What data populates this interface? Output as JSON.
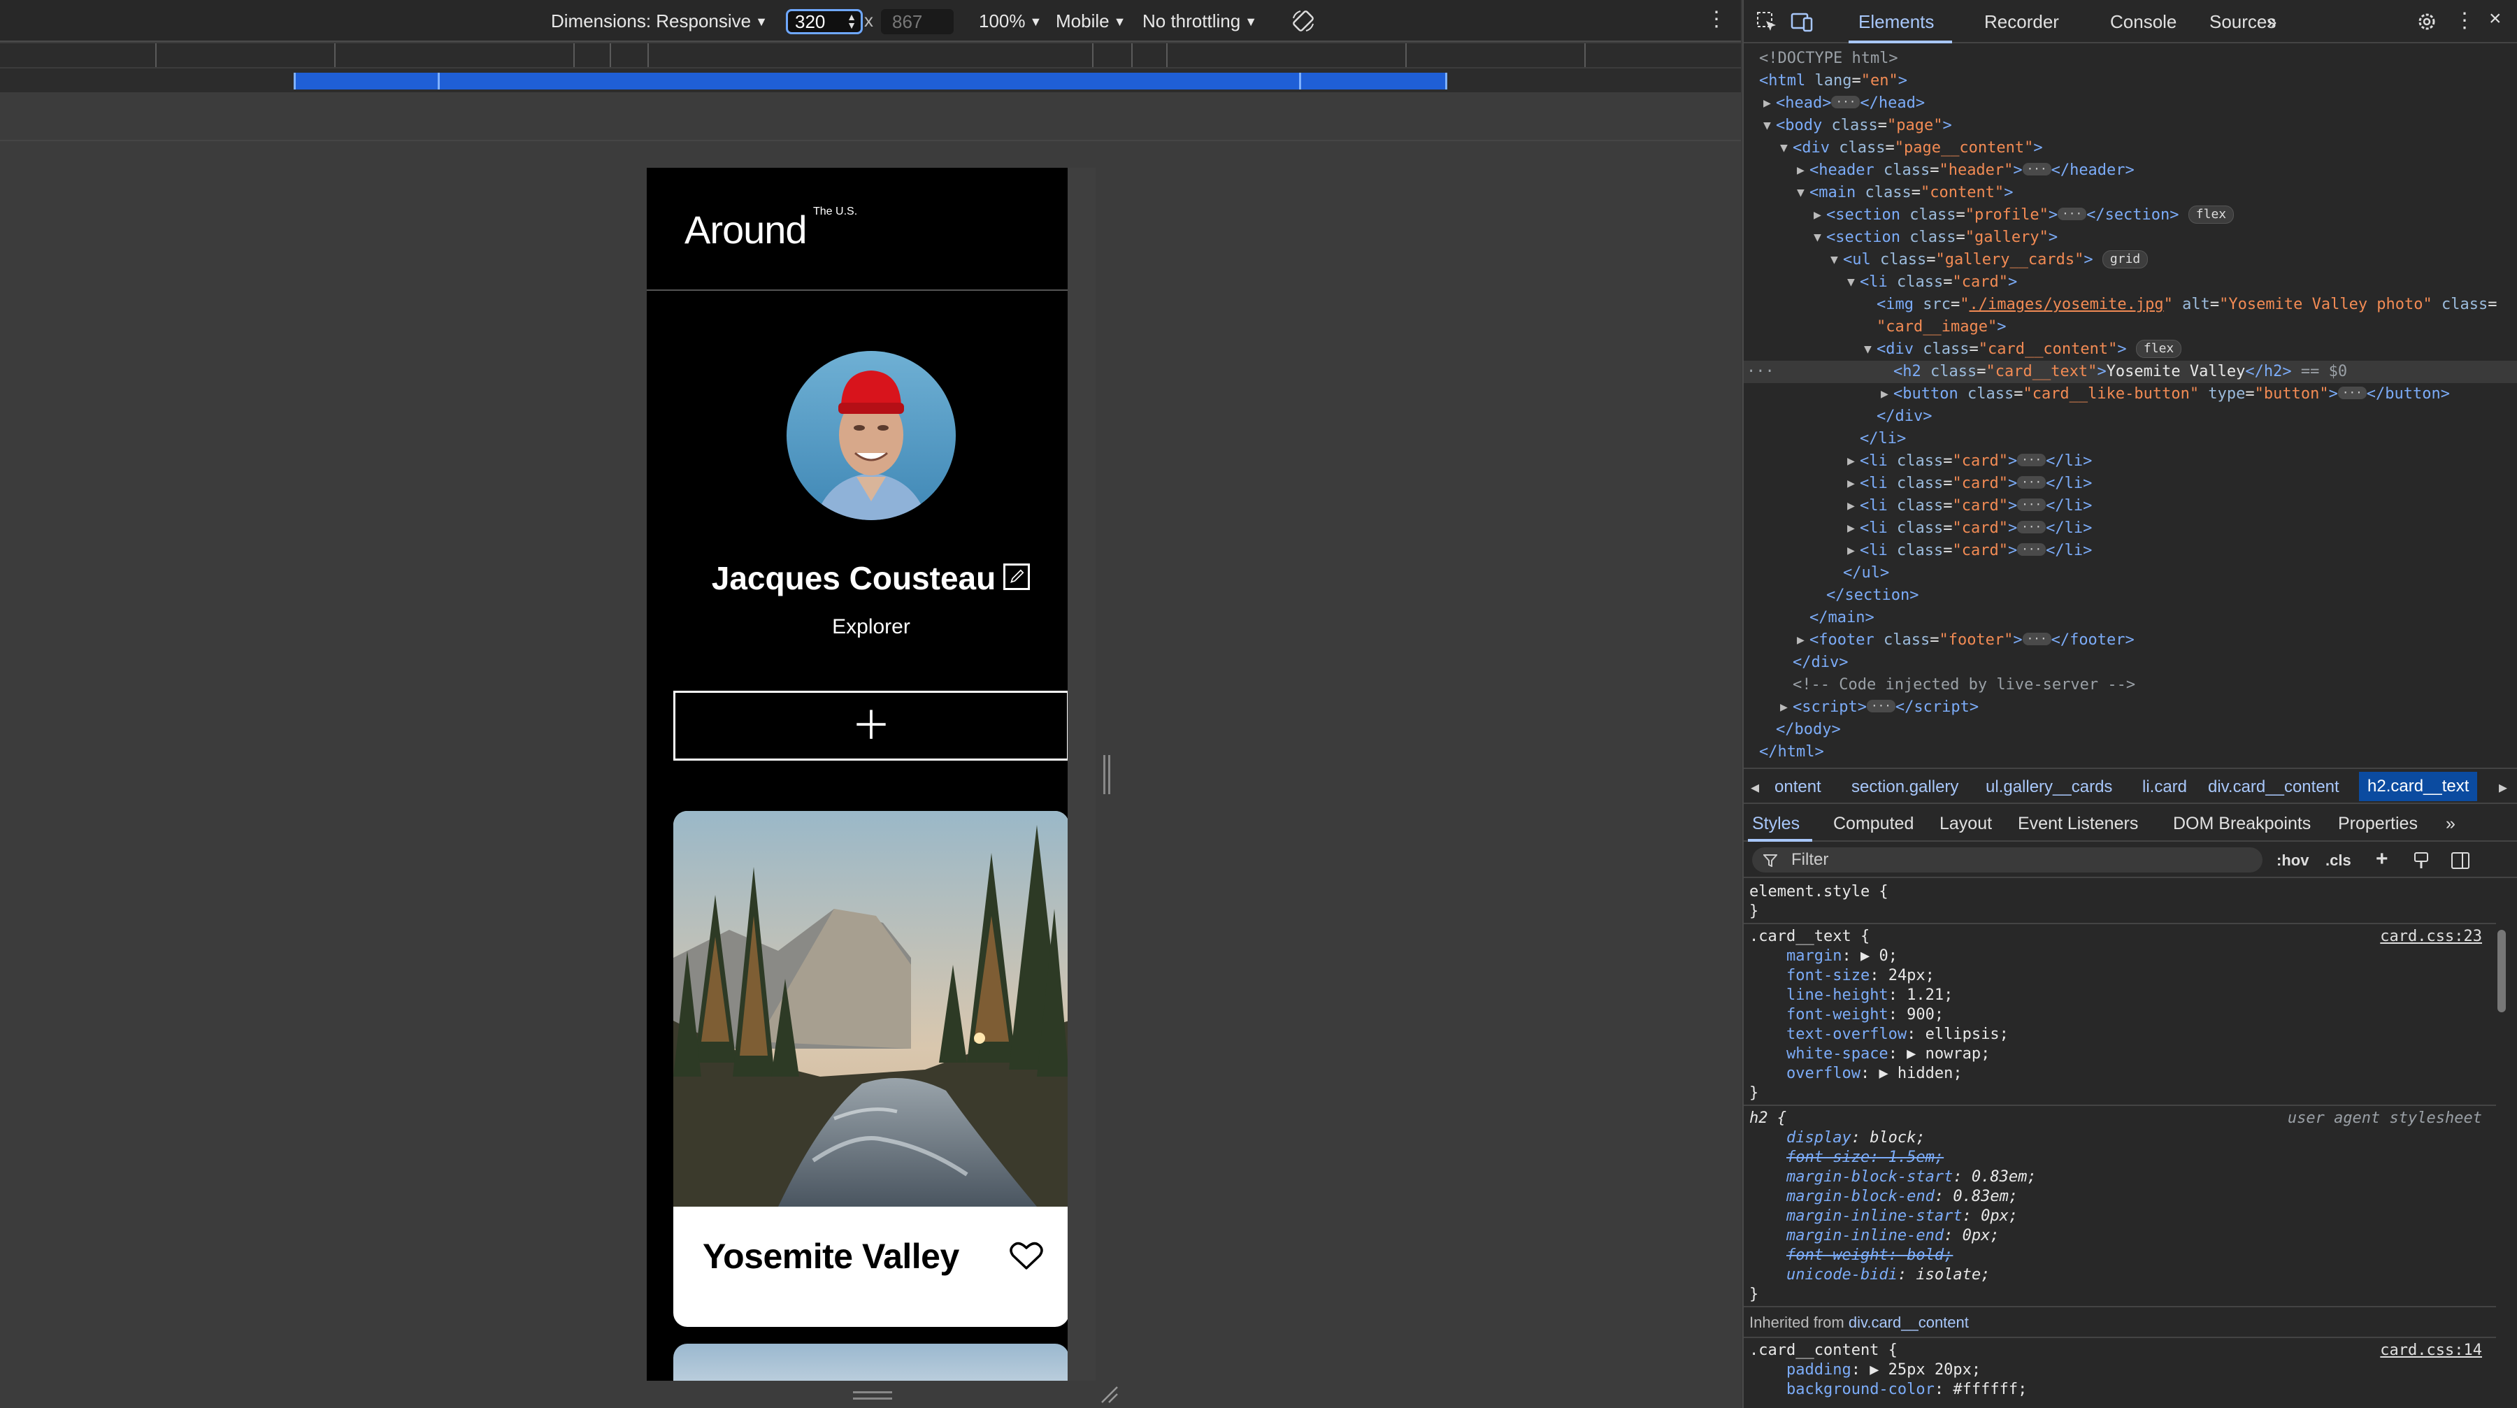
{
  "emulation_toolbar": {
    "dimensions_label": "Dimensions: Responsive",
    "width_value": "320",
    "times": "x",
    "height_value": "867",
    "zoom": "100%",
    "device_type": "Mobile",
    "throttling": "No throttling"
  },
  "site": {
    "logo": "Around",
    "logo_sup": "The U.S.",
    "profile_name": "Jacques Cousteau",
    "profile_about": "Explorer",
    "add_button_symbol": "+",
    "card_title": "Yosemite Valley",
    "card_image_alt": "Yosemite Valley photo"
  },
  "devtools": {
    "tabs": [
      "Elements",
      "Recorder",
      "Console",
      "Sources"
    ],
    "more_tabs": "»",
    "dom_lines": [
      {
        "indent": 0,
        "html": "<span class='cm'>&lt;!DOCTYPE html&gt;</span>"
      },
      {
        "indent": 0,
        "html": "<span class='tg'>&lt;html</span> <span class='at'>lang</span>=<span class='av'>\"en\"</span><span class='tg'>&gt;</span>"
      },
      {
        "indent": 1,
        "tri": "▶",
        "html": "<span class='tg'>&lt;head&gt;</span><span class='ell'>···</span><span class='tg'>&lt;/head&gt;</span>"
      },
      {
        "indent": 1,
        "tri": "▼",
        "html": "<span class='tg'>&lt;body</span> <span class='at'>class</span>=<span class='av'>\"page\"</span><span class='tg'>&gt;</span>"
      },
      {
        "indent": 2,
        "tri": "▼",
        "html": "<span class='tg'>&lt;div</span> <span class='at'>class</span>=<span class='av'>\"page__content\"</span><span class='tg'>&gt;</span>"
      },
      {
        "indent": 3,
        "tri": "▶",
        "html": "<span class='tg'>&lt;header</span> <span class='at'>class</span>=<span class='av'>\"header\"</span><span class='tg'>&gt;</span><span class='ell'>···</span><span class='tg'>&lt;/header&gt;</span>"
      },
      {
        "indent": 3,
        "tri": "▼",
        "html": "<span class='tg'>&lt;main</span> <span class='at'>class</span>=<span class='av'>\"content\"</span><span class='tg'>&gt;</span>"
      },
      {
        "indent": 4,
        "tri": "▶",
        "html": "<span class='tg'>&lt;section</span> <span class='at'>class</span>=<span class='av'>\"profile\"</span><span class='tg'>&gt;</span><span class='ell'>···</span><span class='tg'>&lt;/section&gt;</span> <span class='pill'>flex</span>"
      },
      {
        "indent": 4,
        "tri": "▼",
        "html": "<span class='tg'>&lt;section</span> <span class='at'>class</span>=<span class='av'>\"gallery\"</span><span class='tg'>&gt;</span>"
      },
      {
        "indent": 5,
        "tri": "▼",
        "html": "<span class='tg'>&lt;ul</span> <span class='at'>class</span>=<span class='av'>\"gallery__cards\"</span><span class='tg'>&gt;</span> <span class='pill'>grid</span>"
      },
      {
        "indent": 6,
        "tri": "▼",
        "html": "<span class='tg'>&lt;li</span> <span class='at'>class</span>=<span class='av'>\"card\"</span><span class='tg'>&gt;</span>"
      },
      {
        "indent": 7,
        "html": "<span class='tg'>&lt;img</span> <span class='at'>src</span>=<span class='av'>\"<u>./images/yosemite.jpg</u>\"</span> <span class='at'>alt</span>=<span class='av'>\"Yosemite Valley photo\"</span> <span class='at'>class</span>="
      },
      {
        "indent": 7,
        "html": "<span class='av'>\"card__image\"</span><span class='tg'>&gt;</span>"
      },
      {
        "indent": 7,
        "tri": "▼",
        "html": "<span class='tg'>&lt;div</span> <span class='at'>class</span>=<span class='av'>\"card__content\"</span><span class='tg'>&gt;</span> <span class='pill'>flex</span>"
      },
      {
        "indent": 8,
        "sel": true,
        "html": "<span class='tg'>&lt;h2</span> <span class='at'>class</span>=<span class='av'>\"card__text\"</span><span class='tg'>&gt;</span><span class='tx'>Yosemite Valley</span><span class='tg'>&lt;/h2&gt;</span> <span class='cm'>== $0</span>"
      },
      {
        "indent": 8,
        "tri": "▶",
        "html": "<span class='tg'>&lt;button</span> <span class='at'>class</span>=<span class='av'>\"card__like-button\"</span> <span class='at'>type</span>=<span class='av'>\"button\"</span><span class='tg'>&gt;</span><span class='ell'>···</span><span class='tg'>&lt;/button&gt;</span>"
      },
      {
        "indent": 7,
        "html": "<span class='tg'>&lt;/div&gt;</span>"
      },
      {
        "indent": 6,
        "html": "<span class='tg'>&lt;/li&gt;</span>"
      },
      {
        "indent": 6,
        "tri": "▶",
        "html": "<span class='tg'>&lt;li</span> <span class='at'>class</span>=<span class='av'>\"card\"</span><span class='tg'>&gt;</span><span class='ell'>···</span><span class='tg'>&lt;/li&gt;</span>"
      },
      {
        "indent": 6,
        "tri": "▶",
        "html": "<span class='tg'>&lt;li</span> <span class='at'>class</span>=<span class='av'>\"card\"</span><span class='tg'>&gt;</span><span class='ell'>···</span><span class='tg'>&lt;/li&gt;</span>"
      },
      {
        "indent": 6,
        "tri": "▶",
        "html": "<span class='tg'>&lt;li</span> <span class='at'>class</span>=<span class='av'>\"card\"</span><span class='tg'>&gt;</span><span class='ell'>···</span><span class='tg'>&lt;/li&gt;</span>"
      },
      {
        "indent": 6,
        "tri": "▶",
        "html": "<span class='tg'>&lt;li</span> <span class='at'>class</span>=<span class='av'>\"card\"</span><span class='tg'>&gt;</span><span class='ell'>···</span><span class='tg'>&lt;/li&gt;</span>"
      },
      {
        "indent": 6,
        "tri": "▶",
        "html": "<span class='tg'>&lt;li</span> <span class='at'>class</span>=<span class='av'>\"card\"</span><span class='tg'>&gt;</span><span class='ell'>···</span><span class='tg'>&lt;/li&gt;</span>"
      },
      {
        "indent": 5,
        "html": "<span class='tg'>&lt;/ul&gt;</span>"
      },
      {
        "indent": 4,
        "html": "<span class='tg'>&lt;/section&gt;</span>"
      },
      {
        "indent": 3,
        "html": "<span class='tg'>&lt;/main&gt;</span>"
      },
      {
        "indent": 3,
        "tri": "▶",
        "html": "<span class='tg'>&lt;footer</span> <span class='at'>class</span>=<span class='av'>\"footer\"</span><span class='tg'>&gt;</span><span class='ell'>···</span><span class='tg'>&lt;/footer&gt;</span>"
      },
      {
        "indent": 2,
        "html": "<span class='tg'>&lt;/div&gt;</span>"
      },
      {
        "indent": 2,
        "html": "<span class='cm'>&lt;!-- Code injected by live-server --&gt;</span>"
      },
      {
        "indent": 2,
        "tri": "▶",
        "html": "<span class='tg'>&lt;script&gt;</span><span class='ell'>···</span><span class='tg'>&lt;/script&gt;</span>"
      },
      {
        "indent": 1,
        "html": "<span class='tg'>&lt;/body&gt;</span>"
      },
      {
        "indent": 0,
        "html": "<span class='tg'>&lt;/html&gt;</span>"
      }
    ],
    "breadcrumbs": [
      "ontent",
      "section.gallery",
      "ul.gallery__cards",
      "li.card",
      "div.card__content",
      "h2.card__text"
    ],
    "styles_tabs": [
      "Styles",
      "Computed",
      "Layout",
      "Event Listeners",
      "DOM Breakpoints",
      "Properties"
    ],
    "filter_placeholder": "Filter",
    "filter_tools": [
      ":hov",
      ".cls"
    ],
    "element_style": "element.style {",
    "rule1_selector": ".card__text {",
    "rule1_source": "card.css:23",
    "rule1_props": [
      [
        "margin",
        "▶ 0;"
      ],
      [
        "font-size",
        "24px;"
      ],
      [
        "line-height",
        "1.21;"
      ],
      [
        "font-weight",
        "900;"
      ],
      [
        "text-overflow",
        "ellipsis;"
      ],
      [
        "white-space",
        "▶ nowrap;"
      ],
      [
        "overflow",
        "▶ hidden;"
      ]
    ],
    "rule2_selector": "h2 {",
    "rule2_source": "user agent stylesheet",
    "rule2_props": [
      [
        "display",
        "block;",
        false
      ],
      [
        "font-size",
        "1.5em;",
        true
      ],
      [
        "margin-block-start",
        "0.83em;",
        false
      ],
      [
        "margin-block-end",
        "0.83em;",
        false
      ],
      [
        "margin-inline-start",
        "0px;",
        false
      ],
      [
        "margin-inline-end",
        "0px;",
        false
      ],
      [
        "font-weight",
        "bold;",
        true
      ],
      [
        "unicode-bidi",
        "isolate;",
        false
      ]
    ],
    "inherited_label": "Inherited from",
    "inherited_from": "div.card__content",
    "rule3_selector": ".card__content {",
    "rule3_source": "card.css:14",
    "rule3_props": [
      [
        "padding",
        "▶ 25px 20px;"
      ],
      [
        "background-color",
        "#ffffff;"
      ]
    ]
  }
}
